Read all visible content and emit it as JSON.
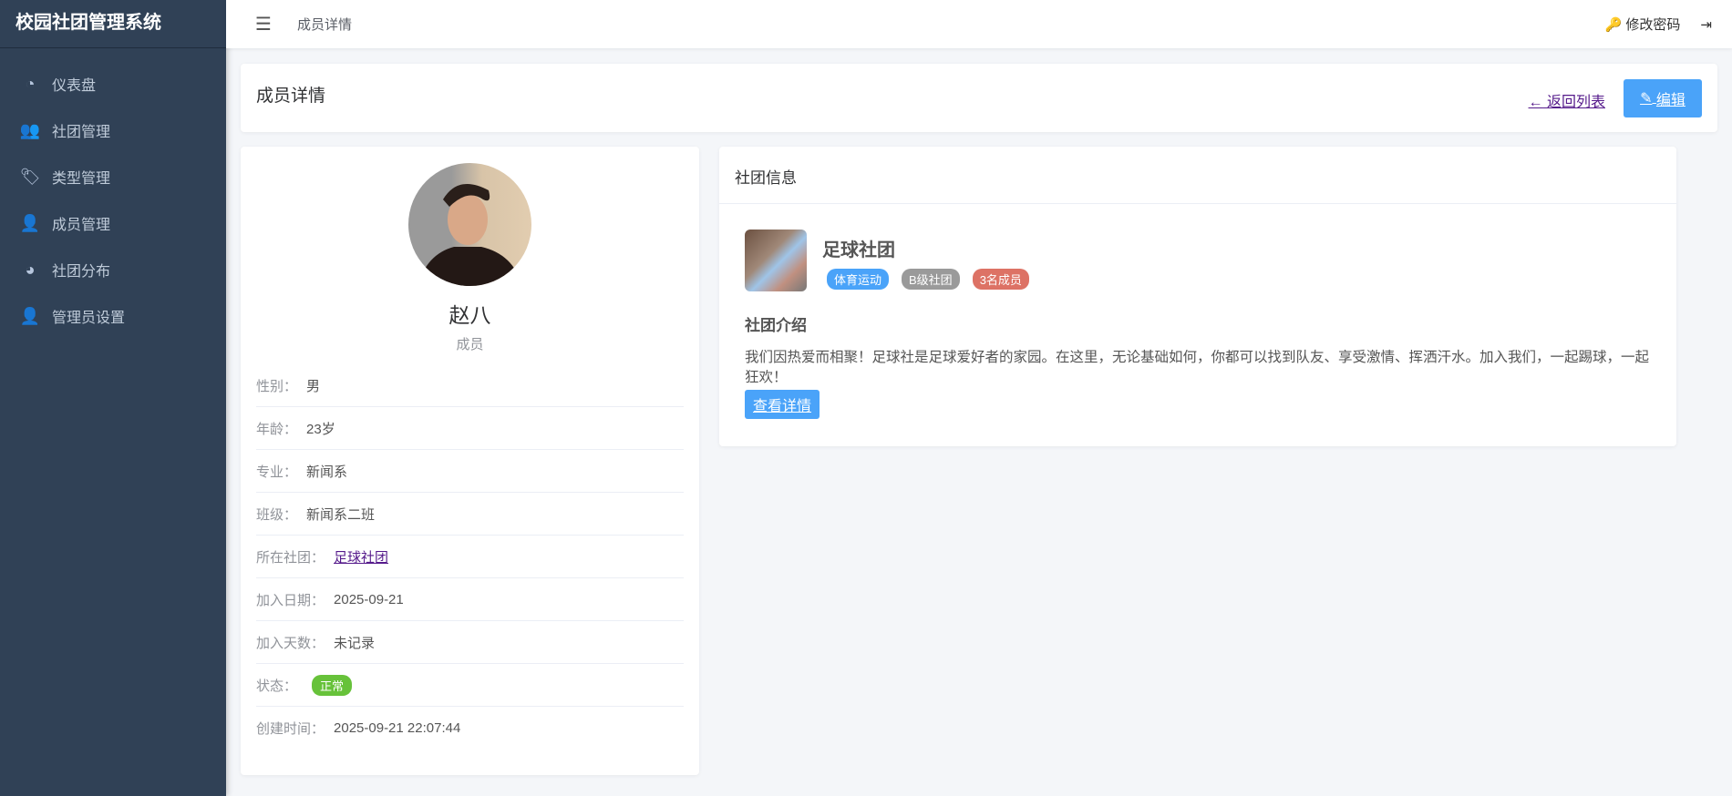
{
  "app_title": "校园社团管理系统",
  "sidebar": {
    "items": [
      {
        "label": "仪表盘",
        "icon": "dashboard-icon"
      },
      {
        "label": "社团管理",
        "icon": "users-icon"
      },
      {
        "label": "类型管理",
        "icon": "tags-icon"
      },
      {
        "label": "成员管理",
        "icon": "user-friends-icon"
      },
      {
        "label": "社团分布",
        "icon": "pie-chart-icon"
      },
      {
        "label": "管理员设置",
        "icon": "user-shield-icon"
      }
    ]
  },
  "header": {
    "breadcrumb": "成员详情",
    "change_password": "修改密码"
  },
  "page": {
    "title": "成员详情",
    "back_label": "返回列表",
    "edit_label": "编辑"
  },
  "member": {
    "name": "赵八",
    "role": "成员",
    "fields": [
      {
        "label": "性别：",
        "value": "男"
      },
      {
        "label": "年龄：",
        "value": "23岁"
      },
      {
        "label": "专业：",
        "value": "新闻系"
      },
      {
        "label": "班级：",
        "value": "新闻系二班"
      },
      {
        "label": "所在社团：",
        "value": "足球社团"
      },
      {
        "label": "加入日期：",
        "value": "2025-09-21"
      },
      {
        "label": "加入天数：",
        "value": "未记录"
      },
      {
        "label": "状态：",
        "value": "正常"
      },
      {
        "label": "创建时间：",
        "value": "2025-09-21 22:07:44"
      }
    ]
  },
  "club": {
    "section_title": "社团信息",
    "name": "足球社团",
    "tags": [
      {
        "label": "体育运动",
        "color": "#4aa3f9"
      },
      {
        "label": "B级社团",
        "color": "#9a9a9a"
      },
      {
        "label": "3名成员",
        "color": "#dd7265"
      }
    ],
    "intro_title": "社团介绍",
    "intro": "我们因热爱而相聚！足球社是足球爱好者的家园。在这里，无论基础如何，你都可以找到队友、享受激情、挥洒汗水。加入我们，一起踢球，一起狂欢！",
    "detail_label": "查看详情"
  }
}
